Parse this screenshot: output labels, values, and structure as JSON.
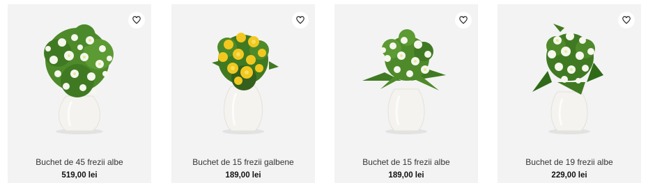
{
  "products": [
    {
      "name": "Buchet de 45 frezii albe",
      "price": "519,00 lei",
      "flower_color": "white"
    },
    {
      "name": "Buchet de 15 frezii galbene",
      "price": "189,00 lei",
      "flower_color": "yellow"
    },
    {
      "name": "Buchet de 15 frezii albe",
      "price": "189,00 lei",
      "flower_color": "white"
    },
    {
      "name": "Buchet de 19 frezii albe",
      "price": "229,00 lei",
      "flower_color": "white"
    }
  ],
  "icons": {
    "favorite": "heart-outline-icon"
  },
  "colors": {
    "card_background": "#f3f3f3",
    "vase": "#f4f3ef",
    "leaf": "#3f7a22",
    "bloom_white": "#f6f7ee",
    "bloom_yellow": "#f2c81f"
  }
}
